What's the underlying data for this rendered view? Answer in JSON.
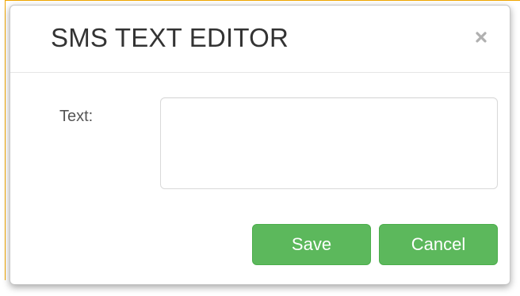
{
  "dialog": {
    "title": "SMS TEXT EDITOR",
    "close_icon": "close-icon",
    "close_symbol": "×"
  },
  "form": {
    "text_label": "Text:",
    "text_value": "",
    "text_placeholder": ""
  },
  "actions": {
    "save_label": "Save",
    "cancel_label": "Cancel"
  },
  "colors": {
    "primary_button": "#5cb85c",
    "focus_border": "#f0a500"
  }
}
